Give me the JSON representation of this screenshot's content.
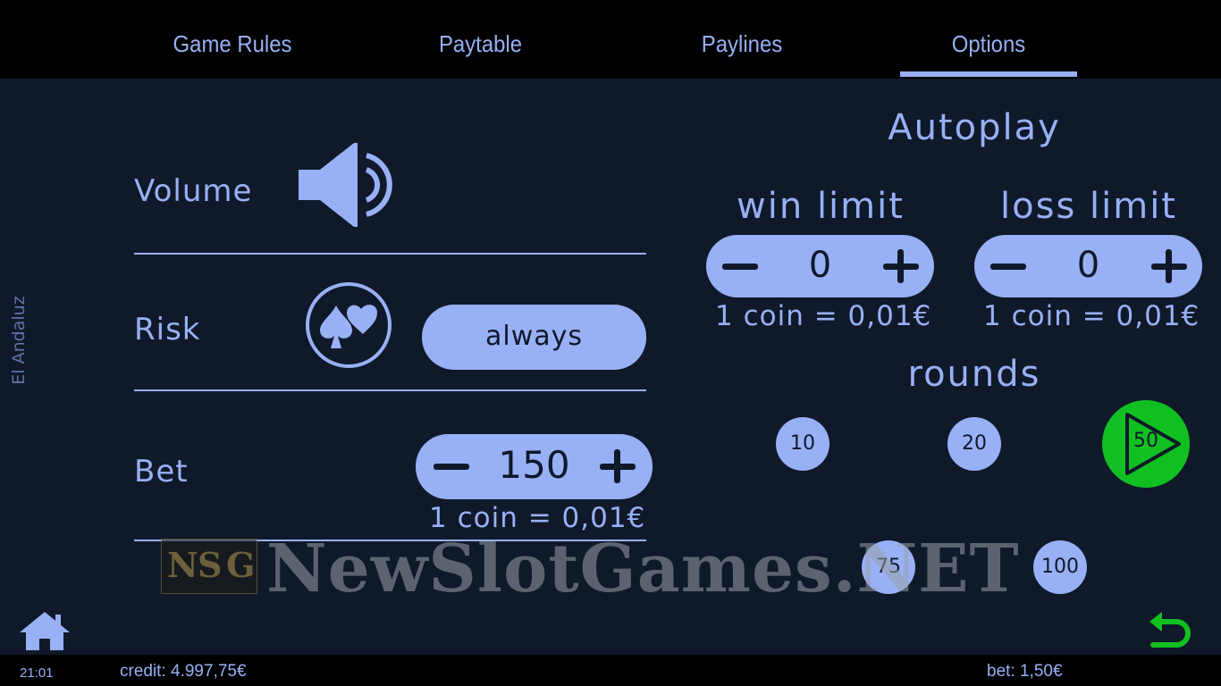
{
  "tabs": [
    {
      "label": "Game Rules"
    },
    {
      "label": "Paytable"
    },
    {
      "label": "Paylines"
    },
    {
      "label": "Options",
      "active": true
    }
  ],
  "game_name": "El Andaluz",
  "volume": {
    "label": "Volume",
    "icon": "speaker-icon"
  },
  "risk": {
    "label": "Risk",
    "icon": "card-suits-icon",
    "value": "always"
  },
  "bet": {
    "label": "Bet",
    "value": "150",
    "coin": "1 coin = 0,01€"
  },
  "autoplay": {
    "title": "Autoplay",
    "win_limit": {
      "label": "win limit",
      "value": "0",
      "coin": "1 coin = 0,01€"
    },
    "loss_limit": {
      "label": "loss limit",
      "value": "0",
      "coin": "1 coin = 0,01€"
    },
    "rounds_label": "rounds",
    "rounds": [
      "10",
      "20",
      "50",
      "75",
      "100"
    ],
    "selected_round": "50"
  },
  "watermark": {
    "logo": [
      "N",
      "S",
      "G"
    ],
    "text": "NewSlotGames.NET"
  },
  "status": {
    "time": "21:01",
    "credit": "credit: 4.997,75€",
    "bet": "bet: 1,50€"
  },
  "colors": {
    "accent": "#98b0f5",
    "background": "#0f1929",
    "active": "#10c020",
    "back_arrow": "#10c020"
  }
}
